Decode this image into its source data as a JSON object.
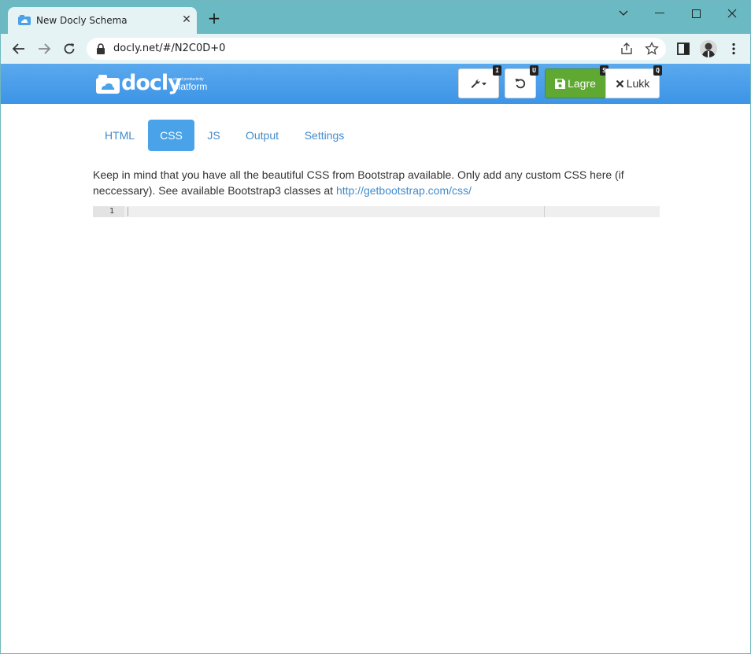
{
  "browser": {
    "tab_title": "New Docly Schema",
    "tab_close": "✕",
    "new_tab": "+",
    "url": "docly.net/#/N2C0D+0"
  },
  "app": {
    "logo_text": "docly",
    "logo_tagline": "cloud productivity",
    "logo_platform": "platform",
    "tools_shortcut": "I",
    "undo_shortcut": "U",
    "save_label": "Lagre",
    "save_shortcut": "S",
    "close_label": "Lukk",
    "close_shortcut": "Q"
  },
  "tabs": [
    {
      "label": "HTML"
    },
    {
      "label": "CSS",
      "active": true
    },
    {
      "label": "JS"
    },
    {
      "label": "Output"
    },
    {
      "label": "Settings"
    }
  ],
  "help": {
    "text": "Keep in mind that you have all the beautiful CSS from Bootstrap available. Only add any custom CSS here (if neccessary). See available Bootstrap3 classes at ",
    "link": "http://getbootstrap.com/css/"
  },
  "editor": {
    "line_number": "1"
  },
  "colors": {
    "header_blue": "#3d94e6",
    "save_green": "#5fa832",
    "link_blue": "#428bca",
    "tab_strip": "#6bbac3"
  }
}
